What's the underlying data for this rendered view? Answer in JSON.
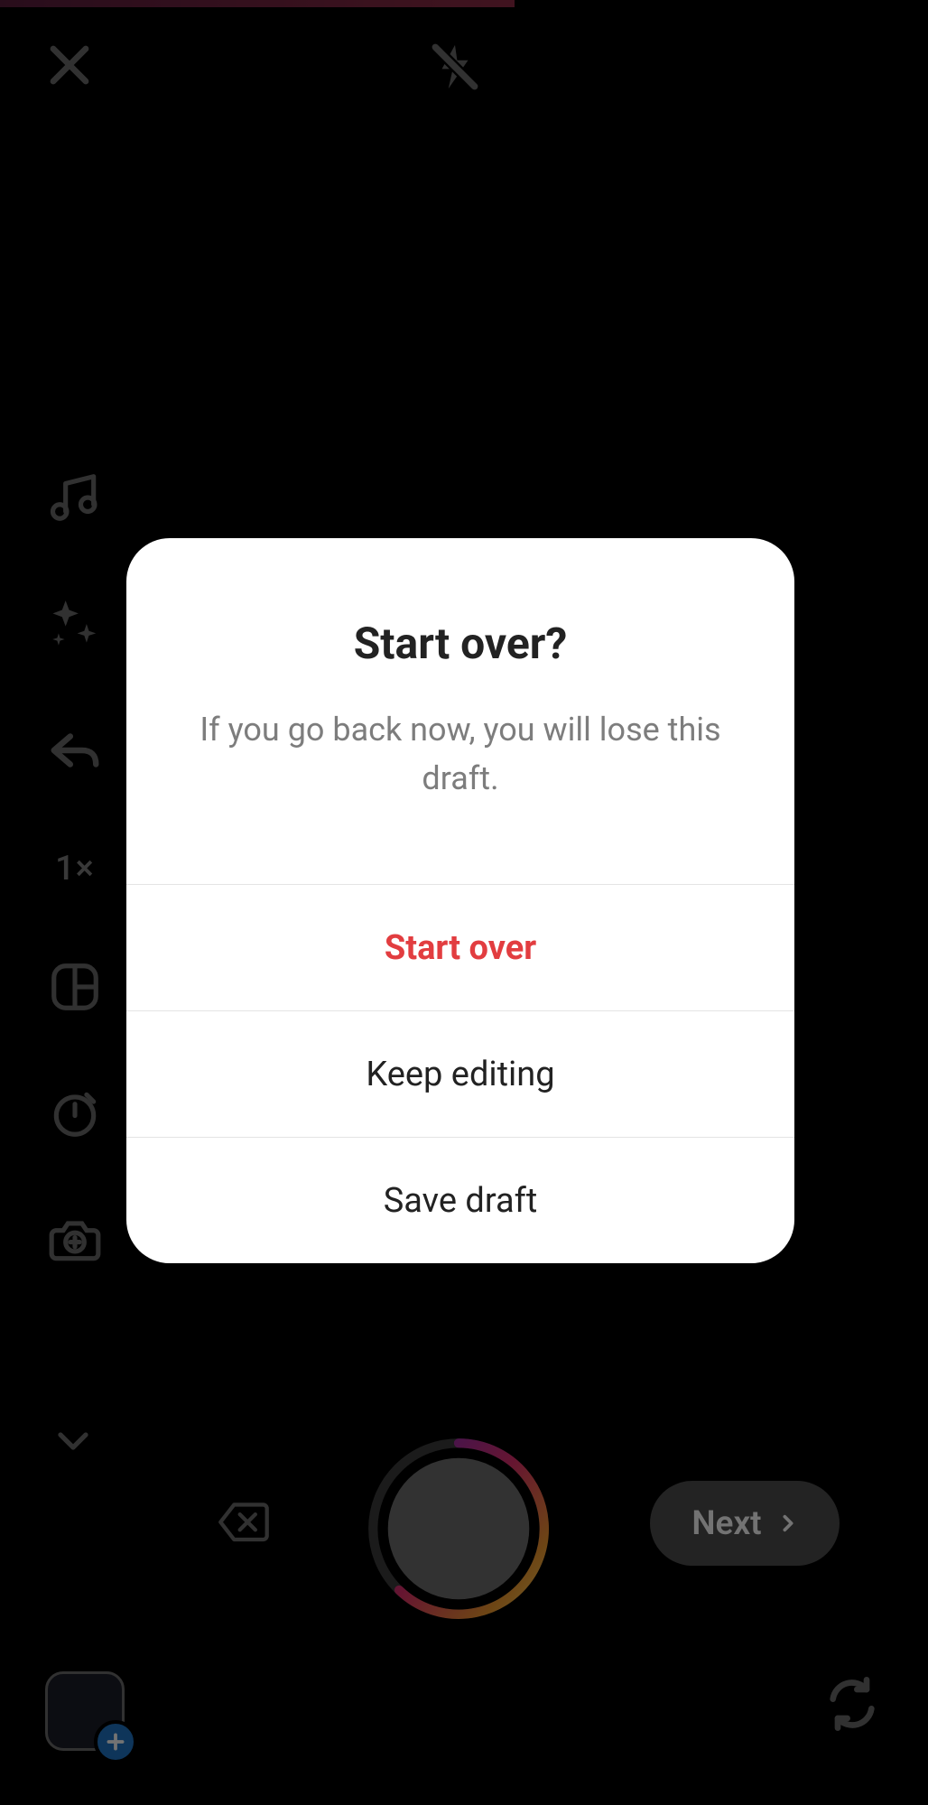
{
  "top": {
    "close_name": "close",
    "flash_name": "flash-off"
  },
  "side": {
    "music": "music",
    "sparkle": "effects",
    "reply": "reply",
    "speed": "1×",
    "layout": "layout",
    "timer": "timer",
    "camera_add": "camera-add"
  },
  "bottom": {
    "delete_last": "delete-last",
    "shutter": "shutter",
    "next_label": "Next",
    "gallery": "gallery-add",
    "switch_camera": "switch-camera"
  },
  "modal": {
    "title": "Start over?",
    "body": "If you go back now, you will lose this draft.",
    "options": {
      "start_over": "Start over",
      "keep_editing": "Keep editing",
      "save_draft": "Save draft"
    }
  }
}
